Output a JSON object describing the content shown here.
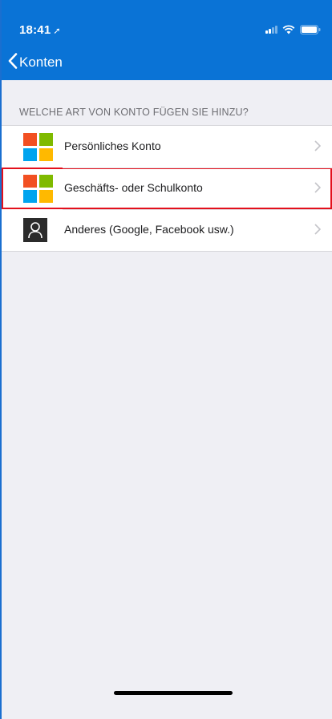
{
  "status_bar": {
    "time": "18:41",
    "location_icon": "location-arrow-icon",
    "signal_icon": "signal-bars-icon",
    "wifi_icon": "wifi-icon",
    "battery_icon": "battery-icon"
  },
  "nav": {
    "back_label": "Konten",
    "back_icon": "chevron-left-icon"
  },
  "section": {
    "header": "WELCHE ART VON KONTO FÜGEN SIE HINZU?"
  },
  "accounts": [
    {
      "label": "Persönliches Konto",
      "icon": "microsoft-logo-icon",
      "highlighted": false
    },
    {
      "label": "Geschäfts- oder Schulkonto",
      "icon": "microsoft-logo-icon",
      "highlighted": true
    },
    {
      "label": "Anderes (Google, Facebook usw.)",
      "icon": "person-icon",
      "highlighted": false
    }
  ],
  "colors": {
    "header_blue": "#0a73d6",
    "ms_red": "#f25022",
    "ms_green": "#7fba00",
    "ms_blue": "#00a4ef",
    "ms_yellow": "#ffb900",
    "highlight_red": "#e3101c"
  }
}
